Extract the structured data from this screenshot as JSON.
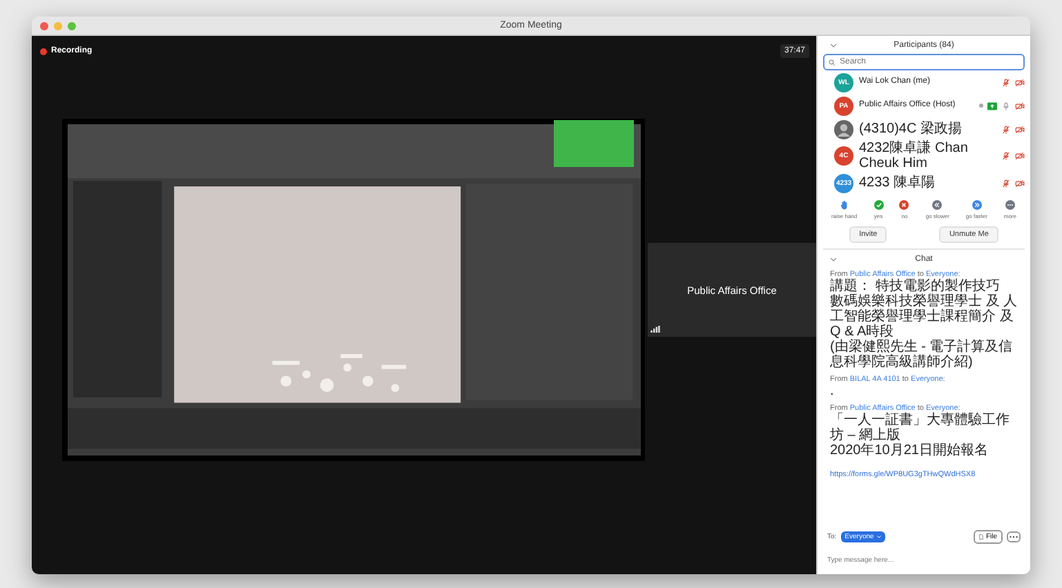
{
  "window": {
    "title": "Zoom Meeting"
  },
  "meeting": {
    "recording": "Recording",
    "timer": "37:47",
    "active_speaker": "Public Affairs Office"
  },
  "participants": {
    "title": "Participants (84)",
    "search": {
      "placeholder": "Search"
    },
    "people": [
      {
        "name": "Wai Lok Chan (me)",
        "kind": "initials",
        "initials": "WL",
        "color": "#1aa39a",
        "sharing": false,
        "mic_muted": true,
        "video_off": true
      },
      {
        "name": "Public Affairs Office (Host)",
        "kind": "initials",
        "initials": "PA",
        "color": "#d8432e",
        "sharing": true,
        "mic_muted": false,
        "video_off": true
      },
      {
        "name": "(4310)4C 梁政揚",
        "kind": "photo",
        "sharing": false,
        "mic_muted": true,
        "video_off": true
      },
      {
        "name": "4232陳卓謙 Chan Cheuk Him",
        "kind": "initials",
        "initials": "4C",
        "color": "#d8432e",
        "sharing": false,
        "mic_muted": true,
        "video_off": true
      },
      {
        "name": "4233 陳卓陽",
        "kind": "initials",
        "initials": "4233",
        "color": "#2f8fd8",
        "sharing": false,
        "mic_muted": true,
        "video_off": true
      }
    ],
    "reactions": [
      {
        "kind": "hand",
        "label": "raise hand",
        "color": "#3f86e0"
      },
      {
        "kind": "check",
        "label": "yes",
        "color": "#22a93a"
      },
      {
        "kind": "cross",
        "label": "no",
        "color": "#d8432e"
      },
      {
        "kind": "slower",
        "label": "go slower",
        "color": "#707684"
      },
      {
        "kind": "faster",
        "label": "go faster",
        "color": "#3f86e0"
      },
      {
        "kind": "more",
        "label": "more",
        "color": "#707684"
      }
    ],
    "buttons": [
      "Invite",
      "Unmute Me"
    ]
  },
  "chat": {
    "title": "Chat",
    "messages": [
      {
        "header": [
          {
            "kind": "plain",
            "text": "From"
          },
          {
            "kind": "name",
            "text": "Public Affairs Office"
          },
          {
            "kind": "plain",
            "text": "to"
          },
          {
            "kind": "name",
            "text": "Everyone"
          },
          {
            "kind": "colon",
            "text": ":"
          }
        ],
        "lines": [
          "講題： 特技電影的製作技巧",
          "數碼娛樂科技榮譽理學士 及 人工智能榮譽理學士課程簡介 及 Q & A時段",
          "(由梁健熙先生 - 電子計算及信息科學院高級講師介紹)"
        ]
      },
      {
        "header": [
          {
            "kind": "plain",
            "text": "From"
          },
          {
            "kind": "name",
            "text": "BILAL 4A 4101"
          },
          {
            "kind": "plain",
            "text": "to"
          },
          {
            "kind": "name",
            "text": "Everyone"
          },
          {
            "kind": "colon",
            "text": ":"
          }
        ],
        "lines": [
          "."
        ]
      },
      {
        "header": [
          {
            "kind": "plain",
            "text": "From"
          },
          {
            "kind": "name",
            "text": "Public Affairs Office"
          },
          {
            "kind": "plain",
            "text": "to"
          },
          {
            "kind": "name",
            "text": "Everyone"
          },
          {
            "kind": "colon",
            "text": ":"
          }
        ],
        "lines": [
          "「一人一証書」大專體驗工作坊 – 網上版",
          "2020年10月21日開始報名"
        ],
        "link": "https://forms.gle/WP8UG3gTHwQWdHSX8"
      }
    ],
    "to_label": "To:",
    "to_value": "Everyone",
    "file_button": "File",
    "input": {
      "placeholder": "Type message here..."
    }
  }
}
